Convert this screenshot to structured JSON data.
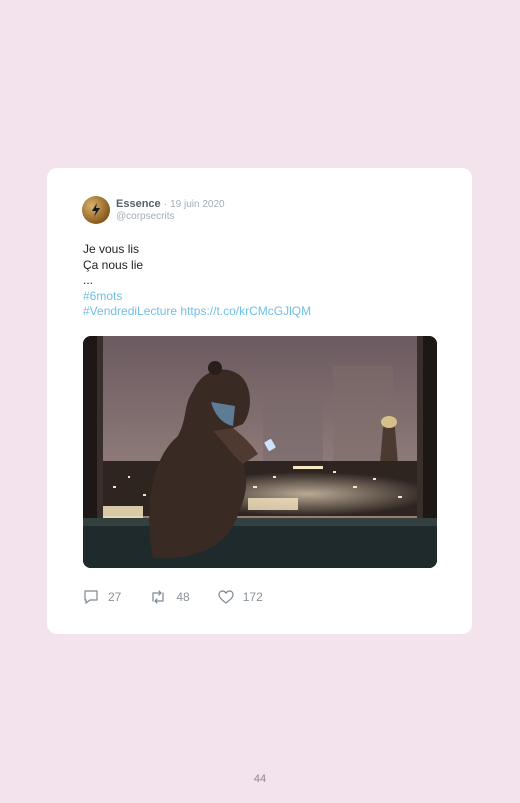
{
  "tweet": {
    "author": "Essence",
    "separator": "·",
    "date": "19 juin 2020",
    "handle": "@corpsecrits",
    "lines": [
      "Je vous lis",
      "Ça nous lie",
      "..."
    ],
    "hashtag_1": "#6mots",
    "hashtag_2": "#VendrediLecture",
    "link": "https://t.co/krCMcGJlQM",
    "stats": {
      "replies": "27",
      "retweets": "48",
      "likes": "172"
    }
  },
  "page_number": "44",
  "colors": {
    "page_background": "#f3e3ec",
    "card_background": "#ffffff",
    "link": "#6fbfe6"
  }
}
